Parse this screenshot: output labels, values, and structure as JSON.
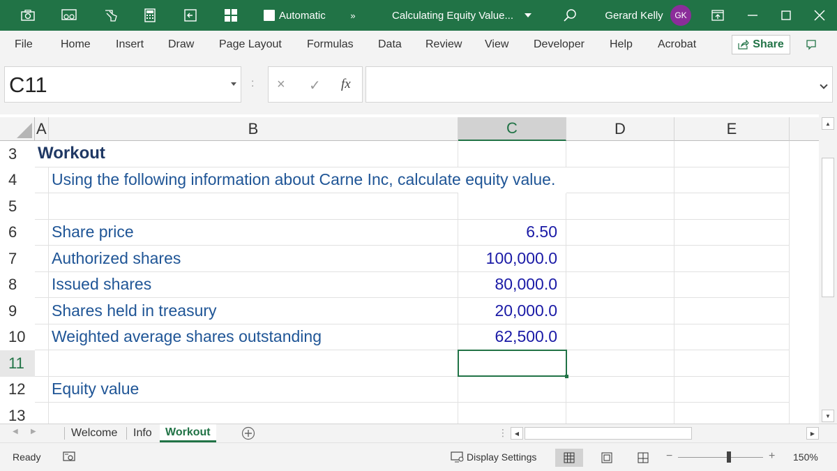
{
  "titlebar": {
    "autosave_label": "Automatic",
    "more_label": "»",
    "doc_title": "Calculating Equity Value...",
    "user_name": "Gerard Kelly",
    "user_initials": "GK"
  },
  "ribbon": {
    "tabs": [
      "File",
      "Home",
      "Insert",
      "Draw",
      "Page Layout",
      "Formulas",
      "Data",
      "Review",
      "View",
      "Developer",
      "Help",
      "Acrobat"
    ],
    "share_label": "Share"
  },
  "formula_bar": {
    "name_box": "C11",
    "separator": ":",
    "cancel": "×",
    "enter": "✓",
    "fx": "fx",
    "formula": ""
  },
  "columns": [
    "A",
    "B",
    "C",
    "D",
    "E"
  ],
  "selected_column": "C",
  "rows": [
    {
      "num": "3",
      "a": "Workout",
      "b": "",
      "c": ""
    },
    {
      "num": "4",
      "a": "",
      "b": "Using the following information about Carne Inc, calculate equity value.",
      "c": ""
    },
    {
      "num": "5",
      "a": "",
      "b": "",
      "c": ""
    },
    {
      "num": "6",
      "a": "",
      "b": "Share price",
      "c": "6.50"
    },
    {
      "num": "7",
      "a": "",
      "b": "Authorized shares",
      "c": "100,000.0"
    },
    {
      "num": "8",
      "a": "",
      "b": "Issued shares",
      "c": "80,000.0"
    },
    {
      "num": "9",
      "a": "",
      "b": "Shares held in treasury",
      "c": "20,000.0"
    },
    {
      "num": "10",
      "a": "",
      "b": "Weighted average shares outstanding",
      "c": "62,500.0"
    },
    {
      "num": "11",
      "a": "",
      "b": "",
      "c": ""
    },
    {
      "num": "12",
      "a": "",
      "b": "Equity value",
      "c": ""
    },
    {
      "num": "13",
      "a": "",
      "b": "",
      "c": ""
    }
  ],
  "sheets": [
    "Welcome",
    "Info",
    "Workout"
  ],
  "active_sheet": "Workout",
  "status": {
    "ready": "Ready",
    "display_settings": "Display Settings",
    "zoom_minus": "−",
    "zoom_plus": "+",
    "zoom": "150%"
  },
  "colors": {
    "accent": "#217346",
    "title_text": "#1f3864",
    "label_text": "#1f5596",
    "number_text": "#1a1aa6"
  }
}
